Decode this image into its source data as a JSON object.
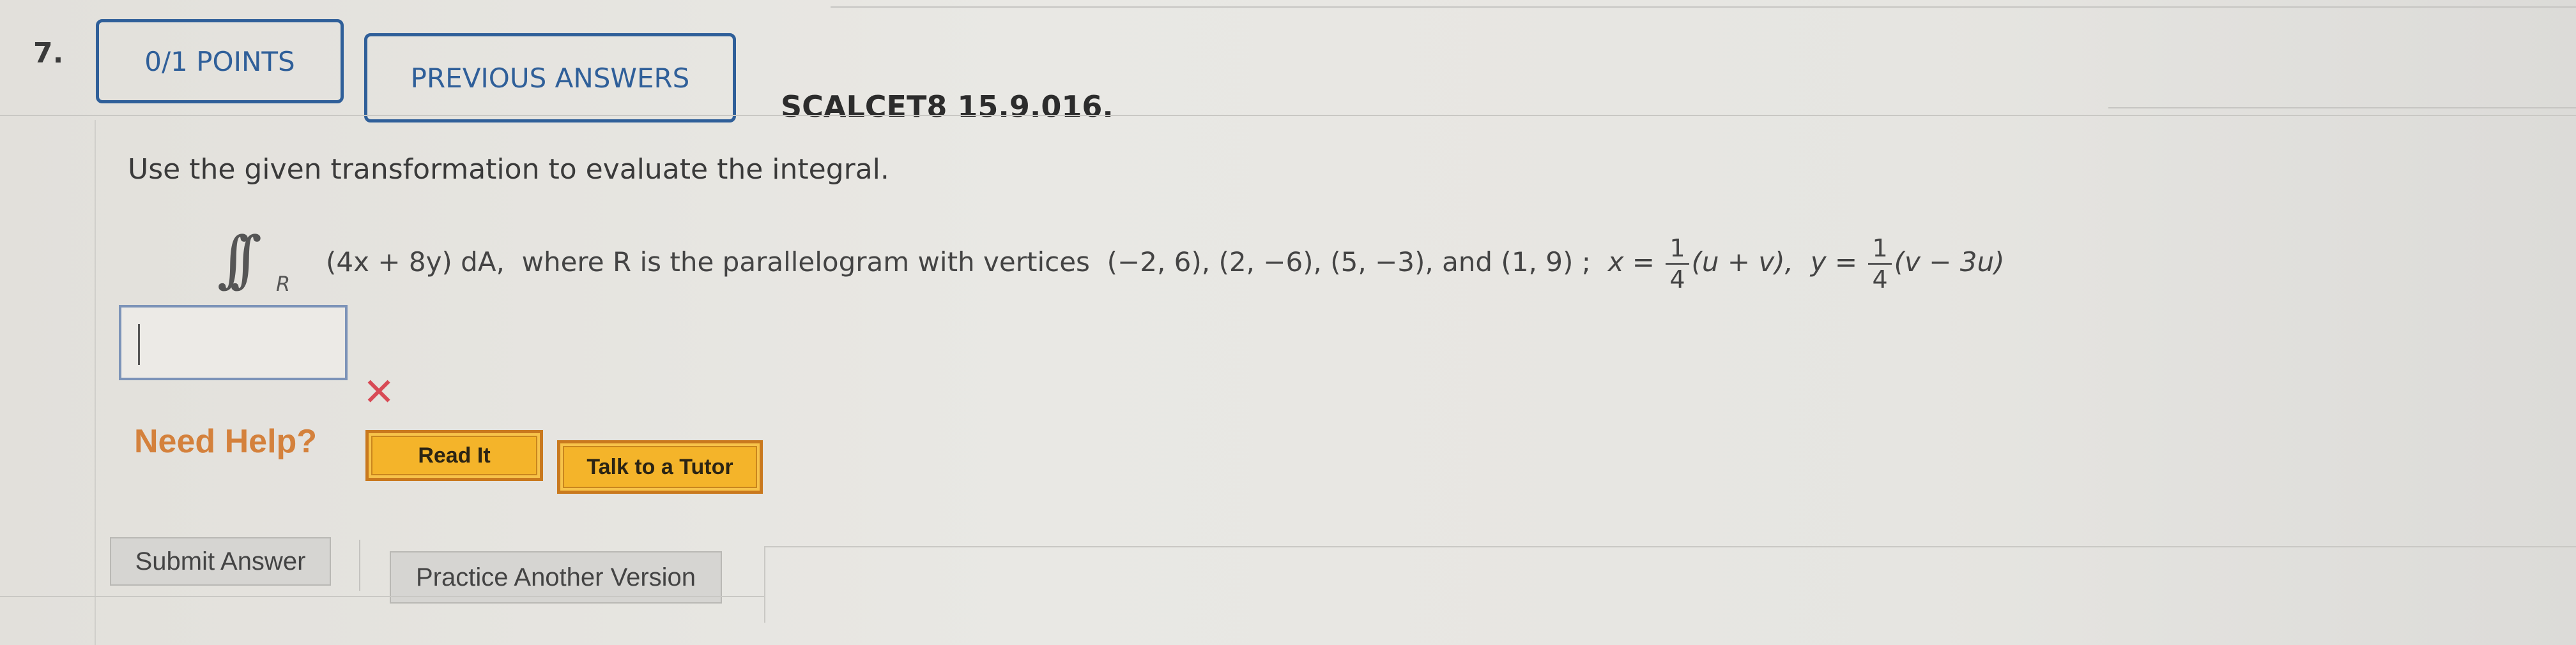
{
  "question": {
    "number": "7.",
    "points_label": "0/1 POINTS",
    "previous_answers_label": "PREVIOUS ANSWERS",
    "code": "SCALCET8 15.9.016.",
    "prompt": "Use the given transformation to evaluate the integral.",
    "integral": {
      "sign": "∫∫",
      "region_subscript": "R",
      "integrand": "(4x + 8y) dA,",
      "description": "where R is the parallelogram with vertices",
      "vertices": "(−2, 6),  (2, −6),  (5, −3),  and  (1, 9) ;",
      "x_lhs": "x =",
      "x_frac_num": "1",
      "x_frac_den": "4",
      "x_rhs": "(u + v),",
      "y_lhs": "y =",
      "y_frac_num": "1",
      "y_frac_den": "4",
      "y_rhs": "(v − 3u)"
    }
  },
  "answer": {
    "value": "",
    "status": "incorrect",
    "status_icon": "✕",
    "status_color": "#d84a55"
  },
  "help": {
    "label": "Need Help?",
    "read_it": "Read It",
    "talk_to_tutor": "Talk to a Tutor"
  },
  "actions": {
    "submit": "Submit Answer",
    "practice": "Practice Another Version"
  },
  "colors": {
    "accent_blue": "#2f5f99",
    "help_orange": "#d4813c",
    "help_button": "#f4b42a"
  }
}
